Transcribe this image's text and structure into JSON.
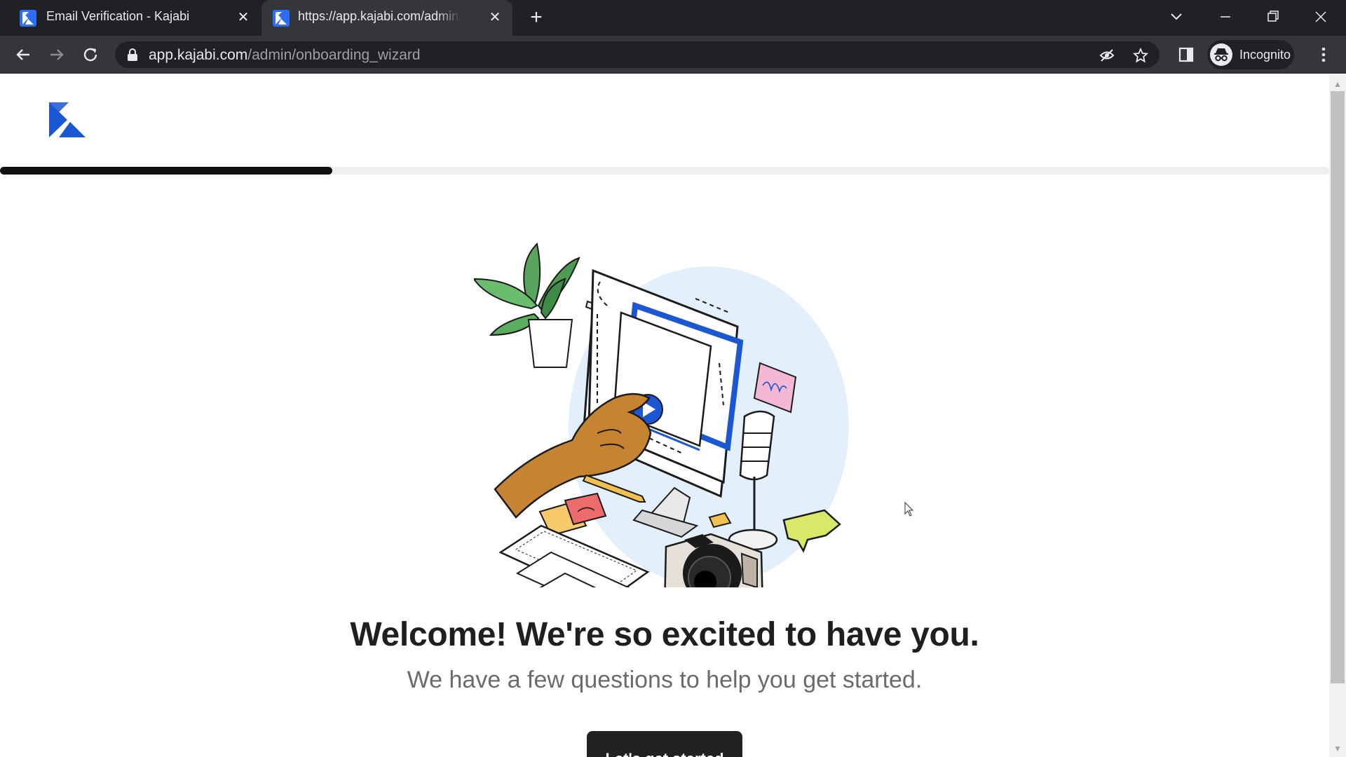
{
  "browser": {
    "tabs": [
      {
        "title": "Email Verification - Kajabi",
        "active": false
      },
      {
        "title": "https://app.kajabi.com/admin/onboarding_wizard",
        "active": true
      }
    ],
    "address_bar": {
      "host": "app.kajabi.com",
      "path": "/admin/onboarding_wizard"
    },
    "profile_label": "Incognito"
  },
  "page": {
    "brand_color": "#1b56d3",
    "progress_fraction": 0.25,
    "headline": "Welcome! We're so excited to have you.",
    "subheadline": "We have a few questions to help you get started.",
    "cta_label": "Let's get started"
  }
}
